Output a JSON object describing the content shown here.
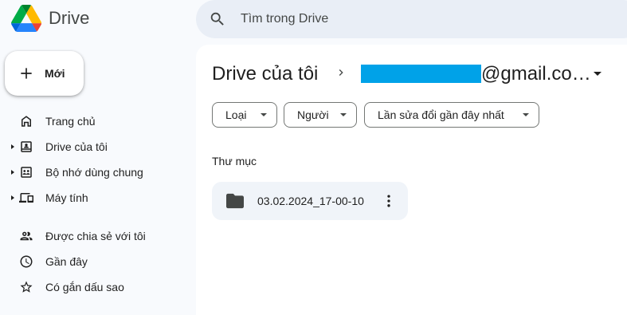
{
  "header": {
    "app_name": "Drive",
    "search_placeholder": "Tìm trong Drive"
  },
  "new_button": {
    "label": "Mới"
  },
  "sidebar": {
    "items": [
      {
        "label": "Trang chủ",
        "icon": "home-icon",
        "expandable": false
      },
      {
        "label": "Drive của tôi",
        "icon": "my-drive-icon",
        "expandable": true
      },
      {
        "label": "Bộ nhớ dùng chung",
        "icon": "shared-drives-icon",
        "expandable": true
      },
      {
        "label": "Máy tính",
        "icon": "computers-icon",
        "expandable": true
      },
      {
        "label": "Được chia sẻ với tôi",
        "icon": "shared-with-me-icon",
        "expandable": false
      },
      {
        "label": "Gần đây",
        "icon": "recent-icon",
        "expandable": false
      },
      {
        "label": "Có gắn dấu sao",
        "icon": "star-icon",
        "expandable": false
      }
    ]
  },
  "breadcrumb": {
    "title": "Drive của tôi",
    "email_suffix": "@gmail.co…"
  },
  "filters": [
    {
      "label": "Loại"
    },
    {
      "label": "Người"
    },
    {
      "label": "Lần sửa đổi gần đây nhất"
    }
  ],
  "folders_section": {
    "label": "Thư mục",
    "items": [
      {
        "name": "03.02.2024_17-00-10",
        "icon": "folder-icon"
      }
    ]
  },
  "colors": {
    "background": "#f8fafd",
    "search_bg": "#e9eef6",
    "redaction": "#00a2e8",
    "folder_card_bg": "#f0f4f9"
  }
}
